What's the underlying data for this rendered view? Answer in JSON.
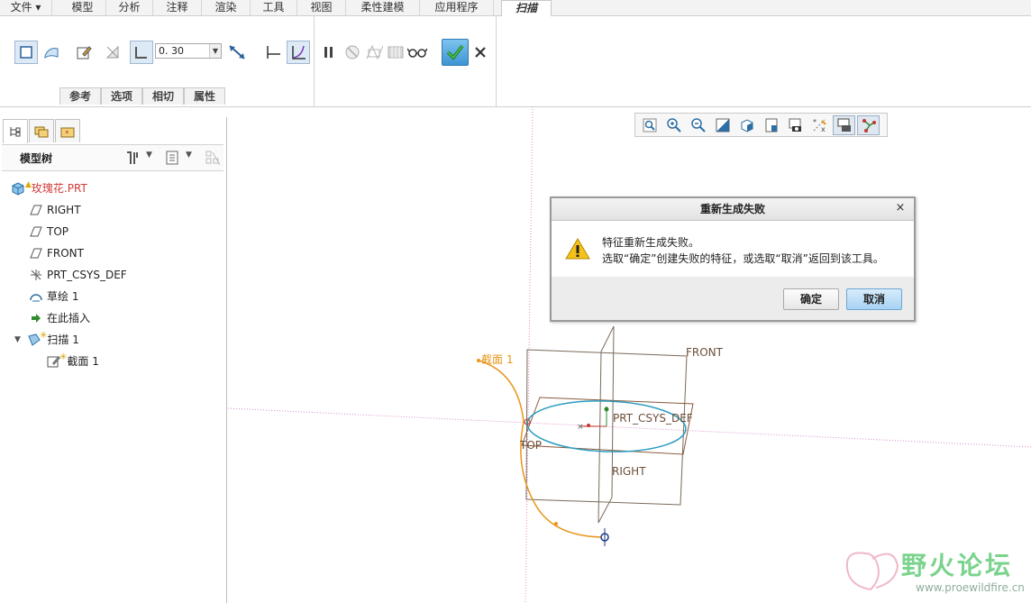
{
  "menu": {
    "file": "文件",
    "model": "模型",
    "analysis": "分析",
    "annotate": "注释",
    "render": "渲染",
    "tools": "工具",
    "view": "视图",
    "flexible": "柔性建模",
    "apps": "应用程序",
    "sweep": "扫描"
  },
  "ribbon": {
    "thickness_value": "0. 30",
    "tabs": [
      "参考",
      "选项",
      "相切",
      "属性"
    ]
  },
  "tree": {
    "header": "模型树",
    "items": [
      "玫瑰花.PRT",
      "RIGHT",
      "TOP",
      "FRONT",
      "PRT_CSYS_DEF",
      "草绘 1",
      "在此插入",
      "扫描 1",
      "截面 1"
    ]
  },
  "viewport": {
    "labels": {
      "front": "FRONT",
      "prt_csys": "PRT_CSYS_DEF",
      "top": "TOP",
      "right": "RIGHT",
      "section": "截面 1"
    }
  },
  "dialog": {
    "title": "重新生成失败",
    "close": "×",
    "line1": "特征重新生成失败。",
    "line2": "选取“确定”创建失败的特征，或选取“取消”返回到该工具。",
    "ok": "确定",
    "cancel": "取消"
  },
  "watermark": {
    "title": "野火论坛",
    "url": "www.proewildfire.cn"
  },
  "colors": {
    "accent": "#1b6fc9",
    "curve_orange": "#e8961a",
    "ellipse_cyan": "#2a9cc0",
    "datum_brown": "#6b4f3a",
    "watermark_green": "#7bd38d"
  }
}
